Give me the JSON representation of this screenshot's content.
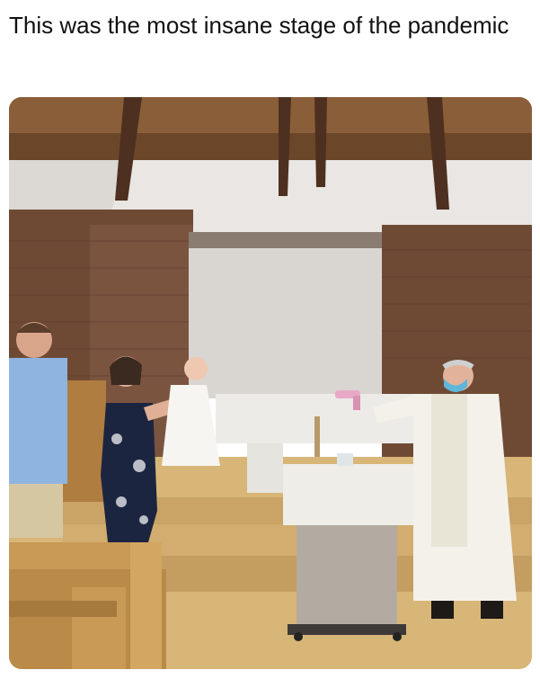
{
  "post": {
    "caption": "This was the most insane stage of the pandemic"
  },
  "photo": {
    "subject": "baptism-scene",
    "colors": {
      "ceiling": "#7a5230",
      "wall": "#e9e6e3",
      "brick": "#6e4a35",
      "floor": "#d8b677",
      "pew": "#c99a55",
      "robe": "#f3f1ea",
      "mask": "#5fb6d9",
      "water_gun": "#e8a9c6"
    }
  }
}
